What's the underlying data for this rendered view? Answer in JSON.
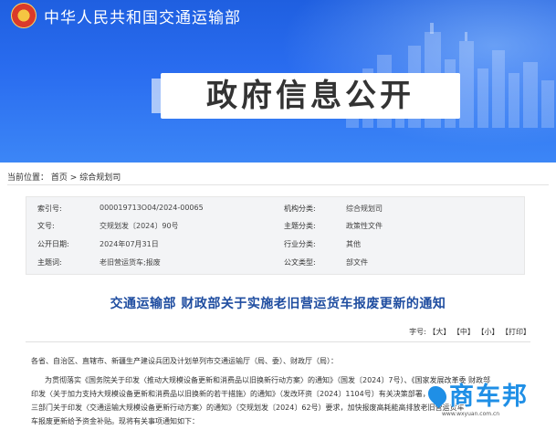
{
  "header": {
    "ministry_name": "中华人民共和国交通运输部",
    "banner_title": "政府信息公开"
  },
  "breadcrumb": {
    "label": "当前位置：",
    "items": [
      "首页",
      "综合规划司"
    ],
    "separator": ">"
  },
  "info_table": [
    {
      "k1": "索引号:",
      "v1": "000019713O04/2024-00065",
      "k2": "机构分类:",
      "v2": "综合规划司"
    },
    {
      "k1": "文号:",
      "v1": "交规划发〔2024〕90号",
      "k2": "主题分类:",
      "v2": "政策性文件"
    },
    {
      "k1": "公开日期:",
      "v1": "2024年07月31日",
      "k2": "行业分类:",
      "v2": "其他"
    },
    {
      "k1": "主题词:",
      "v1": "老旧营运货车;报废",
      "k2": "公文类型:",
      "v2": "部文件"
    }
  ],
  "document": {
    "title": "交通运输部 财政部关于实施老旧营运货车报废更新的通知",
    "font_size_label": "字号:",
    "font_large": "【大】",
    "font_medium": "【中】",
    "font_small": "【小】",
    "print": "【打印】",
    "addressee": "各省、自治区、直辖市、新疆生产建设兵团及计划单列市交通运输厅（局、委）、财政厅（局）：",
    "para1_line1": "为贯彻落实《国务院关于印发〈推动大规模设备更新和消费品以旧换新行动方案〉的通知》（国发〔2024〕7号）、《国家发展改革委 财政部",
    "para1_line2": "印发〈关于加力支持大规模设备更新和消费品以旧换新的若干措施〉的通知》（发改环资〔2024〕1104号）有关决策部署，按照",
    "para1_line3": "三部门关于印发〈交通运输大规模设备更新行动方案〉的通知》（交规划发〔2024〕62号）要求，加快报废高耗能高排放老旧营运货车",
    "para1_line4": "车报废更新给予资金补贴。现将有关事项通知如下："
  },
  "watermark": {
    "logo_text": "商车邦",
    "url": "www.wxyuan.com.cn"
  },
  "colors": {
    "banner_blue": "#2a6df0",
    "title_blue": "#1f4da0",
    "watermark_blue": "#1f8fe6"
  }
}
